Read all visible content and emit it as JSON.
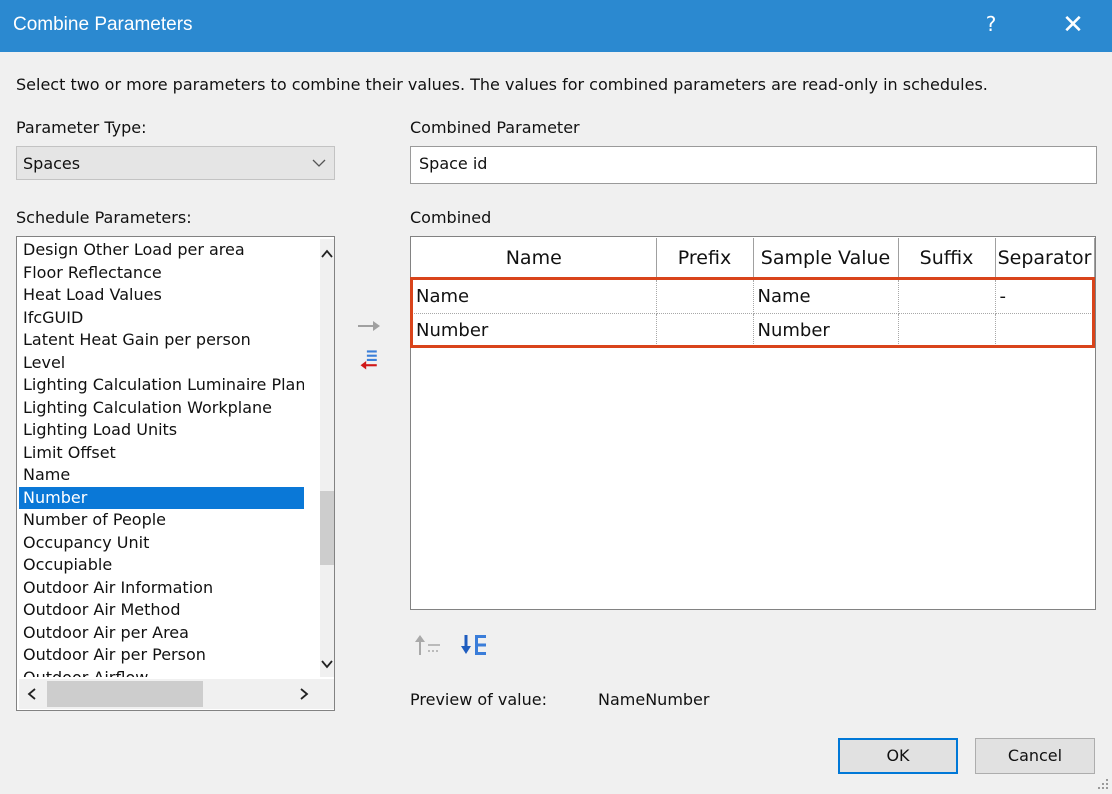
{
  "window": {
    "title": "Combine Parameters",
    "help_label": "?",
    "close_label": "✕"
  },
  "instructions": "Select two or more parameters to combine their values.  The values for combined parameters are read-only in schedules.",
  "parameter_type": {
    "label": "Parameter Type:",
    "value": "Spaces"
  },
  "schedule_parameters": {
    "label": "Schedule Parameters:",
    "items": [
      "Design Other Load per area",
      "Floor Reflectance",
      "Heat Load Values",
      "IfcGUID",
      "Latent Heat Gain per person",
      "Level",
      "Lighting Calculation Luminaire Plane",
      "Lighting Calculation Workplane",
      "Lighting Load Units",
      "Limit Offset",
      "Name",
      "Number",
      "Number of People",
      "Occupancy Unit",
      "Occupiable",
      "Outdoor Air Information",
      "Outdoor Air Method",
      "Outdoor Air per Area",
      "Outdoor Air per Person",
      "Outdoor Airflow"
    ],
    "selected": "Number"
  },
  "combined_parameter": {
    "label": "Combined Parameter",
    "value": "Space id"
  },
  "combined": {
    "label": "Combined",
    "columns": [
      "Name",
      "Prefix",
      "Sample Value",
      "Suffix",
      "Separator"
    ],
    "rows": [
      [
        "Name",
        "",
        "Name",
        "",
        "-"
      ],
      [
        "Number",
        "",
        "Number",
        "",
        ""
      ]
    ]
  },
  "preview": {
    "label": "Preview of value:",
    "value": "NameNumber"
  },
  "buttons": {
    "ok": "OK",
    "cancel": "Cancel"
  },
  "icons": {
    "add": "arrow-right-icon",
    "remove": "remove-parameter-icon",
    "move_up": "move-up-icon",
    "move_down": "move-down-icon"
  },
  "colors": {
    "titlebar": "#2b89d0",
    "selection": "#0a78d7",
    "highlight": "#d9441b",
    "ok_border": "#0078d7"
  }
}
